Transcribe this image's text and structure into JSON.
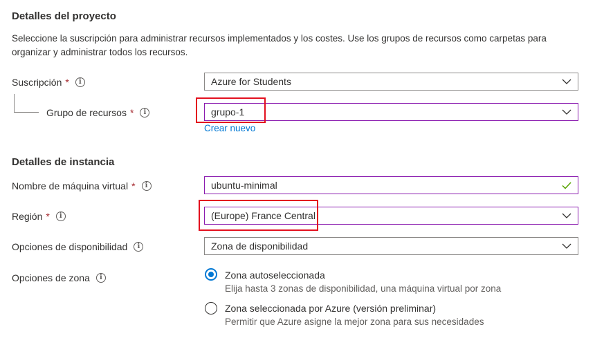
{
  "project": {
    "title": "Detalles del proyecto",
    "description": "Seleccione la suscripción para administrar recursos implementados y los costes. Use los grupos de recursos como carpetas para organizar y administrar todos los recursos."
  },
  "subscription": {
    "label": "Suscripción",
    "value": "Azure for Students"
  },
  "resource_group": {
    "label": "Grupo de recursos",
    "value": "grupo-1",
    "create_link": "Crear nuevo"
  },
  "instance": {
    "title": "Detalles de instancia"
  },
  "vm_name": {
    "label": "Nombre de máquina virtual",
    "value": "ubuntu-minimal"
  },
  "region": {
    "label": "Región",
    "value": "(Europe) France Central"
  },
  "availability": {
    "label": "Opciones de disponibilidad",
    "value": "Zona de disponibilidad"
  },
  "zone_options": {
    "label": "Opciones de zona",
    "options": [
      {
        "title": "Zona autoseleccionada",
        "desc": "Elija hasta 3 zonas de disponibilidad, una máquina virtual por zona",
        "checked": true
      },
      {
        "title": "Zona seleccionada por Azure (versión preliminar)",
        "desc": "Permitir que Azure asigne la mejor zona para sus necesidades",
        "checked": false
      }
    ]
  },
  "symbols": {
    "required": "*",
    "info": "i"
  },
  "colors": {
    "accent": "#0078d4",
    "required": "#a4262c",
    "highlight": "#e3101e",
    "valid": "#57a300",
    "focus_border": "#8a1aaf"
  }
}
